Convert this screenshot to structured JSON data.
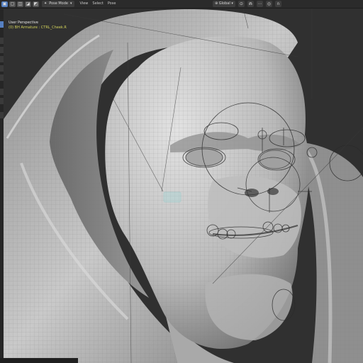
{
  "header": {
    "mode_label": "Pose Mode",
    "menu": [
      "View",
      "Select",
      "Pose"
    ],
    "orientation_label": "Global"
  },
  "viewport": {
    "perspective_label": "User Perspective",
    "object_info": "(0) BH Armature : CTRL_Cheek.R"
  },
  "icons": {
    "mode": "pose-mode-icon",
    "dropdown": "chevron-down-icon",
    "transform": "transform-pivot-icon",
    "snap": "snap-magnet-icon",
    "proportional": "proportional-edit-icon"
  },
  "colors": {
    "accent": "#5680c2",
    "active_object_text": "#d2d25a",
    "viewport_bg": "#303030"
  }
}
